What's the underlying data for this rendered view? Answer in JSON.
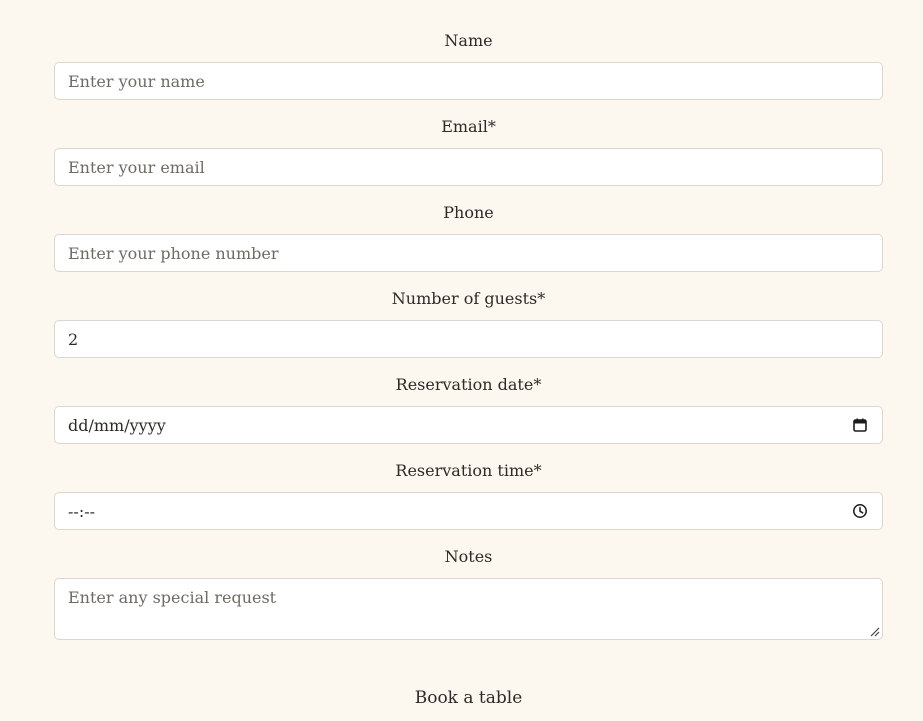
{
  "form": {
    "name": {
      "label": "Name",
      "placeholder": "Enter your name"
    },
    "email": {
      "label": "Email*",
      "placeholder": "Enter your email"
    },
    "phone": {
      "label": "Phone",
      "placeholder": "Enter your phone number"
    },
    "guests": {
      "label": "Number of guests*",
      "value": "2"
    },
    "date": {
      "label": "Reservation date*",
      "value": "dd/mm/yyyy",
      "icon": "calendar-icon"
    },
    "time": {
      "label": "Reservation time*",
      "value": "--:--",
      "icon": "clock-icon"
    },
    "notes": {
      "label": "Notes",
      "placeholder": "Enter any special request"
    },
    "submit_label": "Book a table"
  },
  "colors": {
    "background": "#fcf7ef",
    "input_border": "#dcd7cf",
    "text": "#2e2a26",
    "placeholder": "#6f6a64"
  }
}
